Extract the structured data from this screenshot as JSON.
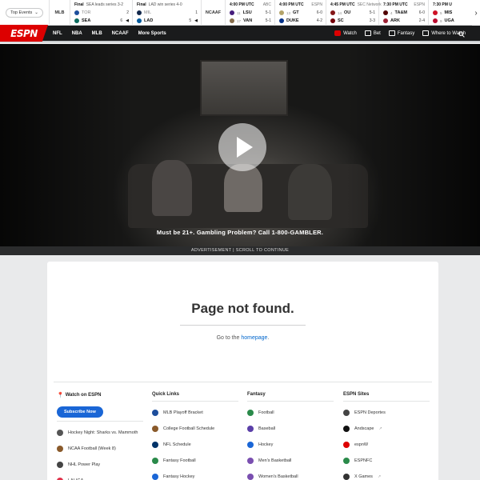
{
  "scores": {
    "top_events_label": "Top Events",
    "league_mlb": "MLB",
    "league_ncaaf": "NCAAF",
    "games": [
      {
        "status": "Final",
        "detail": "SEA leads series 3-2",
        "network": "",
        "teams": [
          {
            "abbr": "TOR",
            "rank": "",
            "score": "2",
            "dim": true,
            "logo": "#1d4e9c",
            "caret": ""
          },
          {
            "abbr": "SEA",
            "rank": "",
            "score": "6",
            "dim": false,
            "logo": "#0c6b5e",
            "caret": "◀"
          }
        ]
      },
      {
        "status": "Final",
        "detail": "LAD win series 4-0",
        "network": "",
        "teams": [
          {
            "abbr": "MIL",
            "rank": "",
            "score": "1",
            "dim": true,
            "logo": "#12284b",
            "caret": ""
          },
          {
            "abbr": "LAD",
            "rank": "",
            "score": "5",
            "dim": false,
            "logo": "#005a9c",
            "caret": "◀"
          }
        ]
      },
      {
        "status": "4:00 PM UTC",
        "detail": "",
        "network": "ABC",
        "teams": [
          {
            "abbr": "LSU",
            "rank": "11",
            "score": "5-1",
            "dim": false,
            "logo": "#461d7c",
            "caret": ""
          },
          {
            "abbr": "VAN",
            "rank": "17",
            "score": "5-1",
            "dim": false,
            "logo": "#866d4b",
            "caret": ""
          }
        ]
      },
      {
        "status": "4:00 PM UTC",
        "detail": "",
        "network": "ESPN",
        "teams": [
          {
            "abbr": "GT",
            "rank": "13",
            "score": "6-0",
            "dim": false,
            "logo": "#b3a369",
            "caret": ""
          },
          {
            "abbr": "DUKE",
            "rank": "",
            "score": "4-2",
            "dim": false,
            "logo": "#003087",
            "caret": ""
          }
        ]
      },
      {
        "status": "4:45 PM UTC",
        "detail": "",
        "network": "SEC Network",
        "teams": [
          {
            "abbr": "OU",
            "rank": "14",
            "score": "5-1",
            "dim": false,
            "logo": "#841617",
            "caret": ""
          },
          {
            "abbr": "SC",
            "rank": "",
            "score": "3-3",
            "dim": false,
            "logo": "#73000a",
            "caret": ""
          }
        ]
      },
      {
        "status": "7:30 PM UTC",
        "detail": "",
        "network": "ESPN",
        "teams": [
          {
            "abbr": "TA&M",
            "rank": "4",
            "score": "6-0",
            "dim": false,
            "logo": "#500000",
            "caret": ""
          },
          {
            "abbr": "ARK",
            "rank": "",
            "score": "2-4",
            "dim": false,
            "logo": "#9d2235",
            "caret": ""
          }
        ]
      },
      {
        "status": "7:30 PM U",
        "detail": "",
        "network": "",
        "teams": [
          {
            "abbr": "MIS",
            "rank": "5",
            "score": "",
            "dim": false,
            "logo": "#ce1126",
            "caret": ""
          },
          {
            "abbr": "UGA",
            "rank": "9",
            "score": "",
            "dim": false,
            "logo": "#ba0c2f",
            "caret": ""
          }
        ]
      }
    ]
  },
  "nav": {
    "logo": "ESPN",
    "links": [
      "NFL",
      "NBA",
      "MLB",
      "NCAAF",
      "More Sports"
    ],
    "watch": "Watch",
    "bet": "Bet",
    "fantasy": "Fantasy",
    "where_to_watch": "Where to Watch"
  },
  "ad": {
    "gambling_text": "Must be 21+. Gambling Problem? Call 1-800-GAMBLER.",
    "bar_text": "ADVERTISEMENT | SCROLL TO CONTINUE"
  },
  "main": {
    "title": "Page not found.",
    "go_to": "Go to the",
    "homepage_link": "homepage",
    "period": "."
  },
  "footer": {
    "watch": {
      "heading": "Watch on ESPN",
      "subscribe": "Subscribe Now",
      "items": [
        {
          "label": "Hockey Night: Sharks vs. Mammoth",
          "color": "#555"
        },
        {
          "label": "NCAA Football (Week 8)",
          "color": "#8a5a2b"
        },
        {
          "label": "NHL Power Play",
          "color": "#444"
        },
        {
          "label": "LALIGA",
          "color": "#e0324b"
        }
      ]
    },
    "quick_links": {
      "heading": "Quick Links",
      "items": [
        {
          "label": "MLB Playoff Bracket",
          "color": "#1d4e9c"
        },
        {
          "label": "College Football Schedule",
          "color": "#8a5a2b"
        },
        {
          "label": "NFL Schedule",
          "color": "#013369"
        },
        {
          "label": "Fantasy Football",
          "color": "#2a8a4a"
        },
        {
          "label": "Fantasy Hockey",
          "color": "#1a66d6"
        }
      ]
    },
    "fantasy": {
      "heading": "Fantasy",
      "items": [
        {
          "label": "Football",
          "color": "#2a8a4a"
        },
        {
          "label": "Baseball",
          "color": "#5b3fa8"
        },
        {
          "label": "Hockey",
          "color": "#1a66d6"
        },
        {
          "label": "Men's Basketball",
          "color": "#7a4fb0"
        },
        {
          "label": "Women's Basketball",
          "color": "#7a4fb0"
        }
      ]
    },
    "espn_sites": {
      "heading": "ESPN Sites",
      "items": [
        {
          "label": "ESPN Deportes",
          "color": "#444",
          "ext": false
        },
        {
          "label": "Andscape",
          "color": "#111",
          "ext": true
        },
        {
          "label": "espnW",
          "color": "#d00",
          "ext": false
        },
        {
          "label": "ESPNFC",
          "color": "#2a8a4a",
          "ext": false
        },
        {
          "label": "X Games",
          "color": "#333",
          "ext": true
        }
      ]
    }
  }
}
